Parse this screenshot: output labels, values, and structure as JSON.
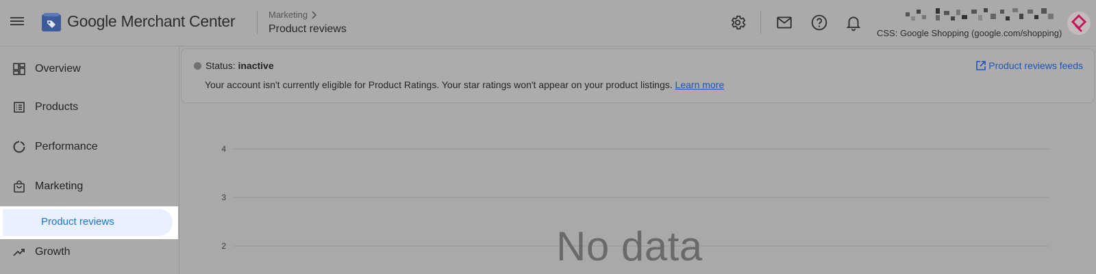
{
  "header": {
    "app_name": "Google Merchant Center",
    "breadcrumb_parent": "Marketing",
    "breadcrumb_current": "Product reviews",
    "css_label": "CSS: Google Shopping (google.com/shopping)",
    "icons": [
      "menu-icon",
      "settings-icon",
      "mail-icon",
      "help-icon",
      "notifications-icon",
      "avatar"
    ]
  },
  "sidebar": {
    "items": [
      {
        "label": "Overview",
        "icon": "overview-icon"
      },
      {
        "label": "Products",
        "icon": "products-icon"
      },
      {
        "label": "Performance",
        "icon": "performance-icon"
      },
      {
        "label": "Marketing",
        "icon": "marketing-icon"
      },
      {
        "label": "Product reviews",
        "icon": ""
      },
      {
        "label": "Growth",
        "icon": "growth-icon"
      }
    ]
  },
  "banner": {
    "status_label": "Status:",
    "status_value": "inactive",
    "message": "Your account isn't currently eligible for Product Ratings. Your star ratings won't appear on your product listings.",
    "learn_more": "Learn more",
    "feeds_link": "Product reviews feeds"
  },
  "chart_data": {
    "type": "line",
    "y_ticks": [
      "4",
      "3",
      "2"
    ],
    "empty_message": "No data",
    "series": []
  },
  "colors": {
    "accent": "#1a73e8",
    "link": "#1c55b8",
    "selected_bg": "#e8f0fe"
  }
}
